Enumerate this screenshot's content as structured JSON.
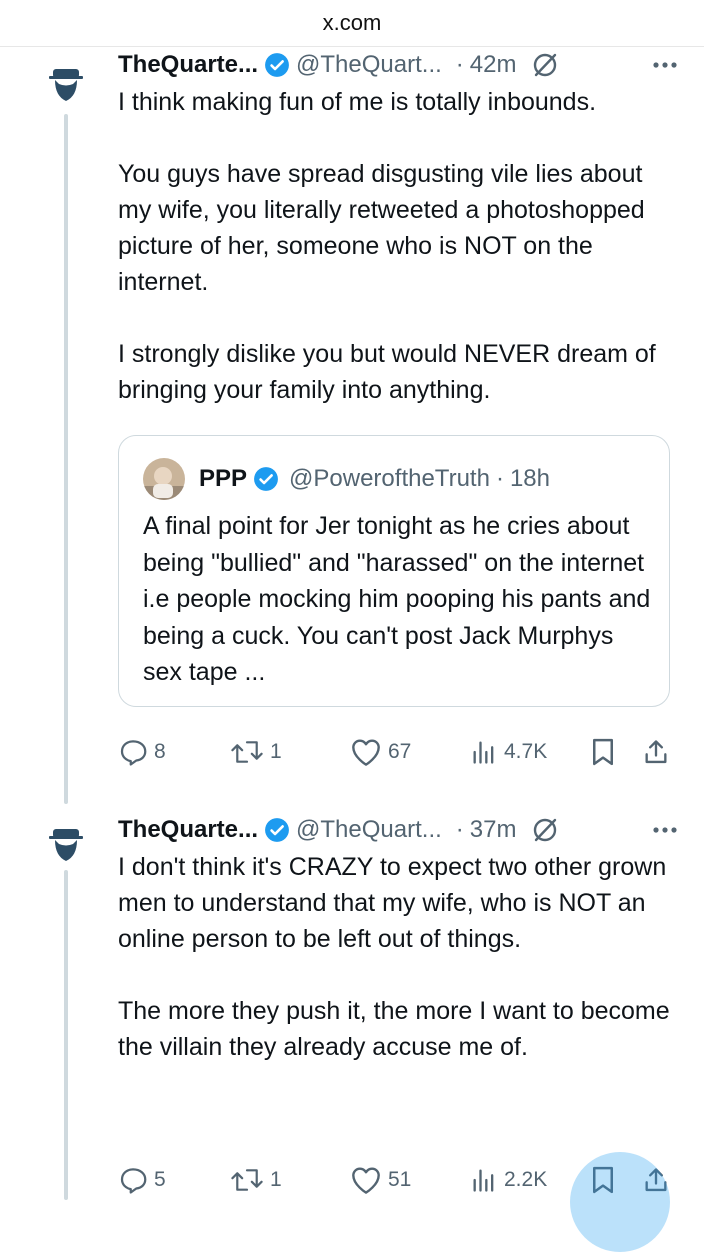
{
  "browser": {
    "url": "x.com"
  },
  "tweets": [
    {
      "name": "TheQuarte...",
      "handle": "@TheQuart...",
      "dot": "·",
      "time": "42m",
      "paragraphs": [
        "I think making fun of me is totally inbounds.",
        "You guys have spread disgusting vile lies about my wife, you literally retweeted a photoshopped picture of her, someone who is NOT on the internet.",
        "I strongly dislike you but would NEVER dream of bringing your family into anything."
      ],
      "quote": {
        "name": "PPP",
        "handle": "@PoweroftheTruth",
        "dot": "·",
        "time": "18h",
        "text": "A final point for Jer tonight as he cries about being \"bullied\" and \"harassed\" on the internet i.e people mocking him pooping his pants and being a cuck. You can't post Jack Murphys sex tape ..."
      },
      "actions": {
        "replies": "8",
        "reposts": "1",
        "likes": "67",
        "views": "4.7K"
      }
    },
    {
      "name": "TheQuarte...",
      "handle": "@TheQuart...",
      "dot": "·",
      "time": "37m",
      "paragraphs": [
        "I don't think it's CRAZY to expect two other grown men to understand that my wife, who is NOT an online person to be left out of things.",
        "The more they push it, the more I want to become the villain they already accuse me of."
      ],
      "actions": {
        "replies": "5",
        "reposts": "1",
        "likes": "51",
        "views": "2.2K"
      }
    }
  ],
  "icons": {
    "verified": "verified-badge-icon",
    "grok": "grok-icon",
    "more": "more-icon",
    "reply": "reply-icon",
    "repost": "repost-icon",
    "like": "like-icon",
    "views": "views-icon",
    "bookmark": "bookmark-icon",
    "share": "share-icon"
  },
  "colors": {
    "verified": "#1d9bf0",
    "secondary_text": "#536471",
    "border": "#cfd9de"
  }
}
